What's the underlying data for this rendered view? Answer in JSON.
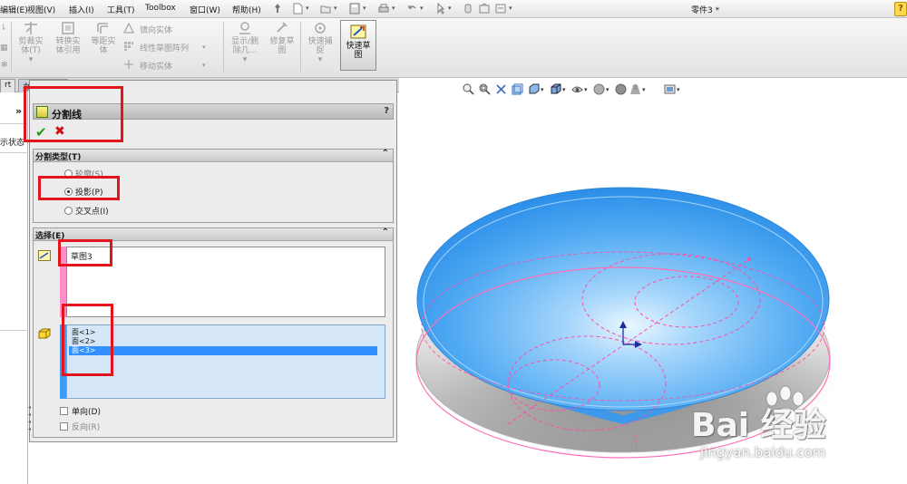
{
  "menu": {
    "items": [
      "编辑(E)",
      "视图(V)",
      "插入(I)",
      "工具(T)",
      "Toolbox",
      "窗口(W)",
      "帮助(H)"
    ],
    "doc_title": "零件3 *",
    "help_icon": "?"
  },
  "toolbar": {
    "tools": [
      {
        "label_1": "剪裁实",
        "label_2": "体(T)",
        "icon": "trim-entities-icon"
      },
      {
        "label_1": "转换实",
        "label_2": "体引用",
        "icon": "convert-entities-icon"
      },
      {
        "label_1": "等距实",
        "label_2": "体",
        "icon": "offset-entities-icon"
      },
      {
        "label_1": "显示/删",
        "label_2": "除几...",
        "icon": "display-delete-relations-icon"
      },
      {
        "label_1": "修复草",
        "label_2": "图",
        "icon": "repair-sketch-icon"
      },
      {
        "label_1": "快速捕",
        "label_2": "捉",
        "icon": "quick-snaps-icon"
      }
    ],
    "small_tools": [
      "镜向实体",
      "线性草图阵列",
      "移动实体"
    ],
    "quick_sketch": {
      "label_1": "快速草",
      "label_2": "图"
    }
  },
  "panel_tabs": [
    "rt",
    "办公室产品"
  ],
  "left_stub": {
    "chevron": "»",
    "text": "示状态"
  },
  "property_manager": {
    "title": "分割线",
    "help": "?",
    "ok": "✔",
    "cancel": "✖",
    "split_type": {
      "header": "分割类型(T)",
      "options": [
        {
          "label": "轮廓(S)",
          "selected": false
        },
        {
          "label": "投影(P)",
          "selected": true
        },
        {
          "label": "交叉点(I)",
          "selected": false
        }
      ]
    },
    "selections": {
      "header": "选择(E)",
      "sketch_item": "草图3",
      "faces": [
        {
          "label": "面<1>",
          "selected": false
        },
        {
          "label": "面<2>",
          "selected": false
        },
        {
          "label": "面<3>",
          "selected": true
        }
      ],
      "single_direction": "单向(D)",
      "reverse_direction": "反向(R)"
    },
    "collapse_glyph": "⌃"
  },
  "watermark": {
    "brand": "Bai 经验",
    "url": "jingyan.baidu.com"
  },
  "colors": {
    "model_blue": "#4aa7f2",
    "sketch_pink": "#ff6fb7",
    "highlight_red": "#e3141b",
    "selection_blue": "#3391ff"
  }
}
